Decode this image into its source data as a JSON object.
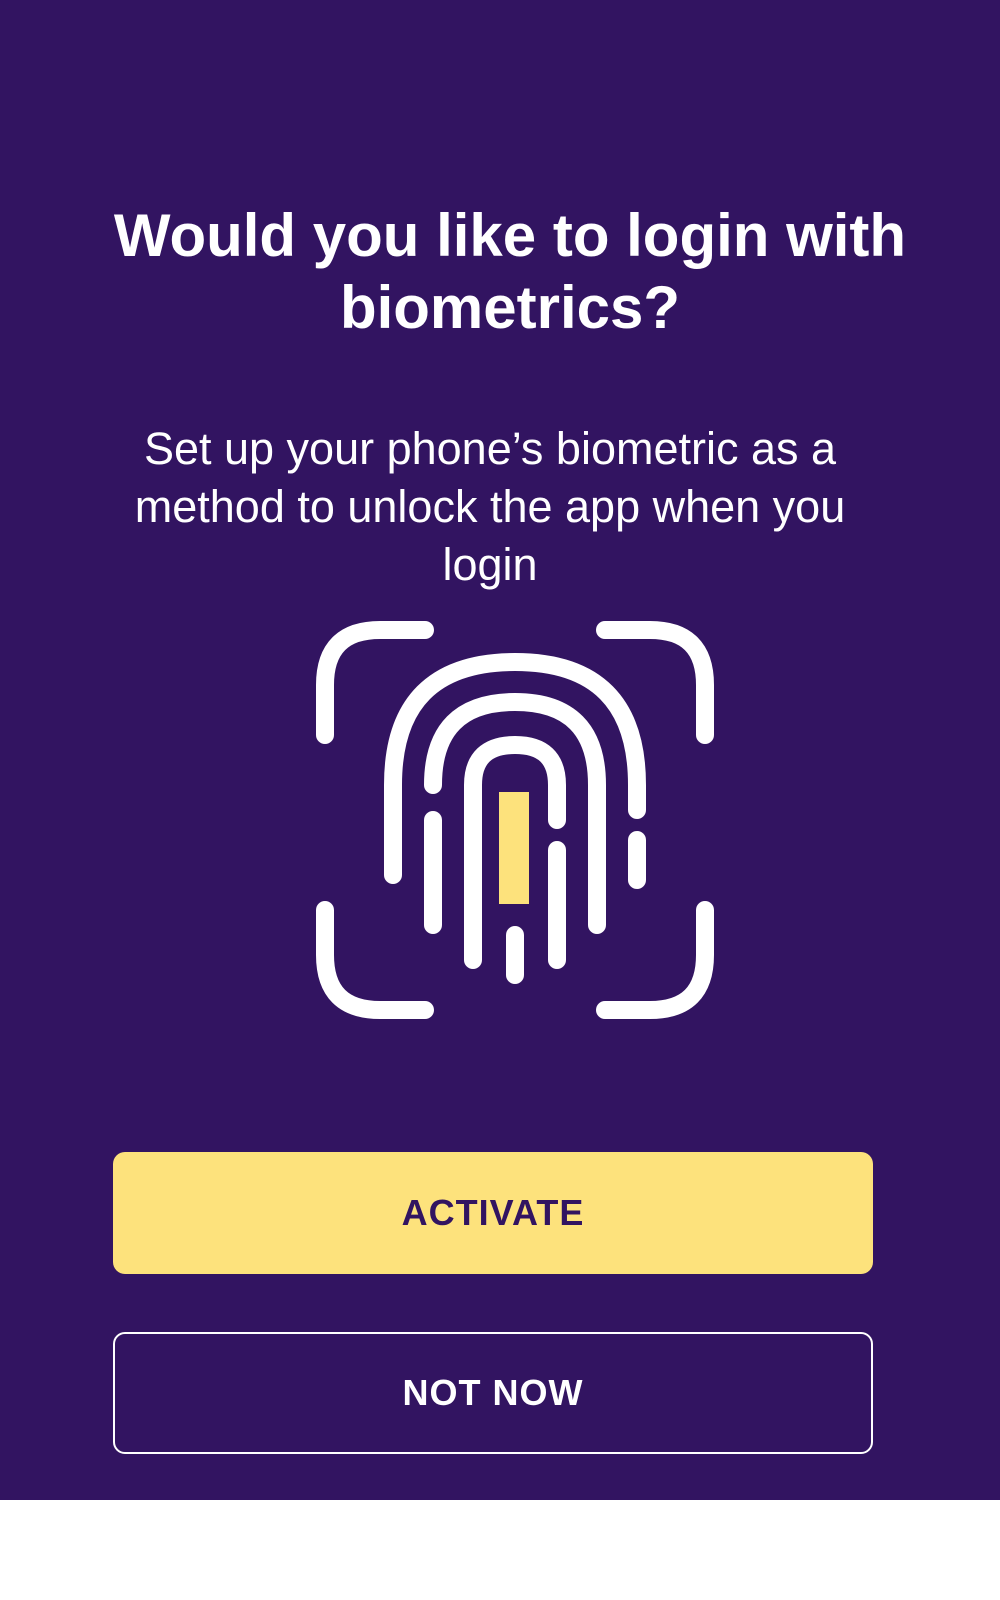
{
  "colors": {
    "background": "#321461",
    "accent": "#fde27c",
    "text": "#ffffff"
  },
  "header": {
    "title": "Would you like to login with biometrics?"
  },
  "body": {
    "description": "Set up your phone’s biometric as a method to unlock the app when you login"
  },
  "illustration": {
    "icon": "fingerprint-scan-icon"
  },
  "actions": {
    "activate_label": "ACTIVATE",
    "not_now_label": "NOT NOW"
  }
}
